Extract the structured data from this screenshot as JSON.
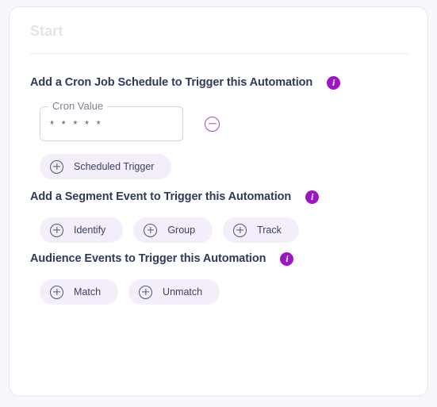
{
  "card": {
    "start_label": "Start"
  },
  "sections": {
    "cron": {
      "title": "Add a Cron Job Schedule to Trigger this Automation",
      "info_icon": "info-icon",
      "info_glyph": "i",
      "input": {
        "label": "Cron Value",
        "value": "* * * * *",
        "placeholder": "* * * * *"
      },
      "remove_icon": "minus-circle-icon",
      "pills": [
        {
          "label": "Scheduled Trigger",
          "icon": "plus-circle-icon"
        }
      ]
    },
    "segment": {
      "title": "Add a Segment Event to Trigger this Automation",
      "info_icon": "info-icon",
      "info_glyph": "i",
      "pills": [
        {
          "label": "Identify",
          "icon": "plus-circle-icon"
        },
        {
          "label": "Group",
          "icon": "plus-circle-icon"
        },
        {
          "label": "Track",
          "icon": "plus-circle-icon"
        }
      ]
    },
    "audience": {
      "title": "Audience Events to Trigger this Automation",
      "info_icon": "info-icon",
      "info_glyph": "i",
      "pills": [
        {
          "label": "Match",
          "icon": "plus-circle-icon"
        },
        {
          "label": "Unmatch",
          "icon": "plus-circle-icon"
        }
      ]
    }
  },
  "colors": {
    "accent_purple": "#9c16c4",
    "remove_purple": "#a93fd6",
    "pill_background": "#f3eefa",
    "heading_text": "#2e3a59",
    "start_text": "#e4e3ea",
    "page_background": "#f7f8fb"
  }
}
